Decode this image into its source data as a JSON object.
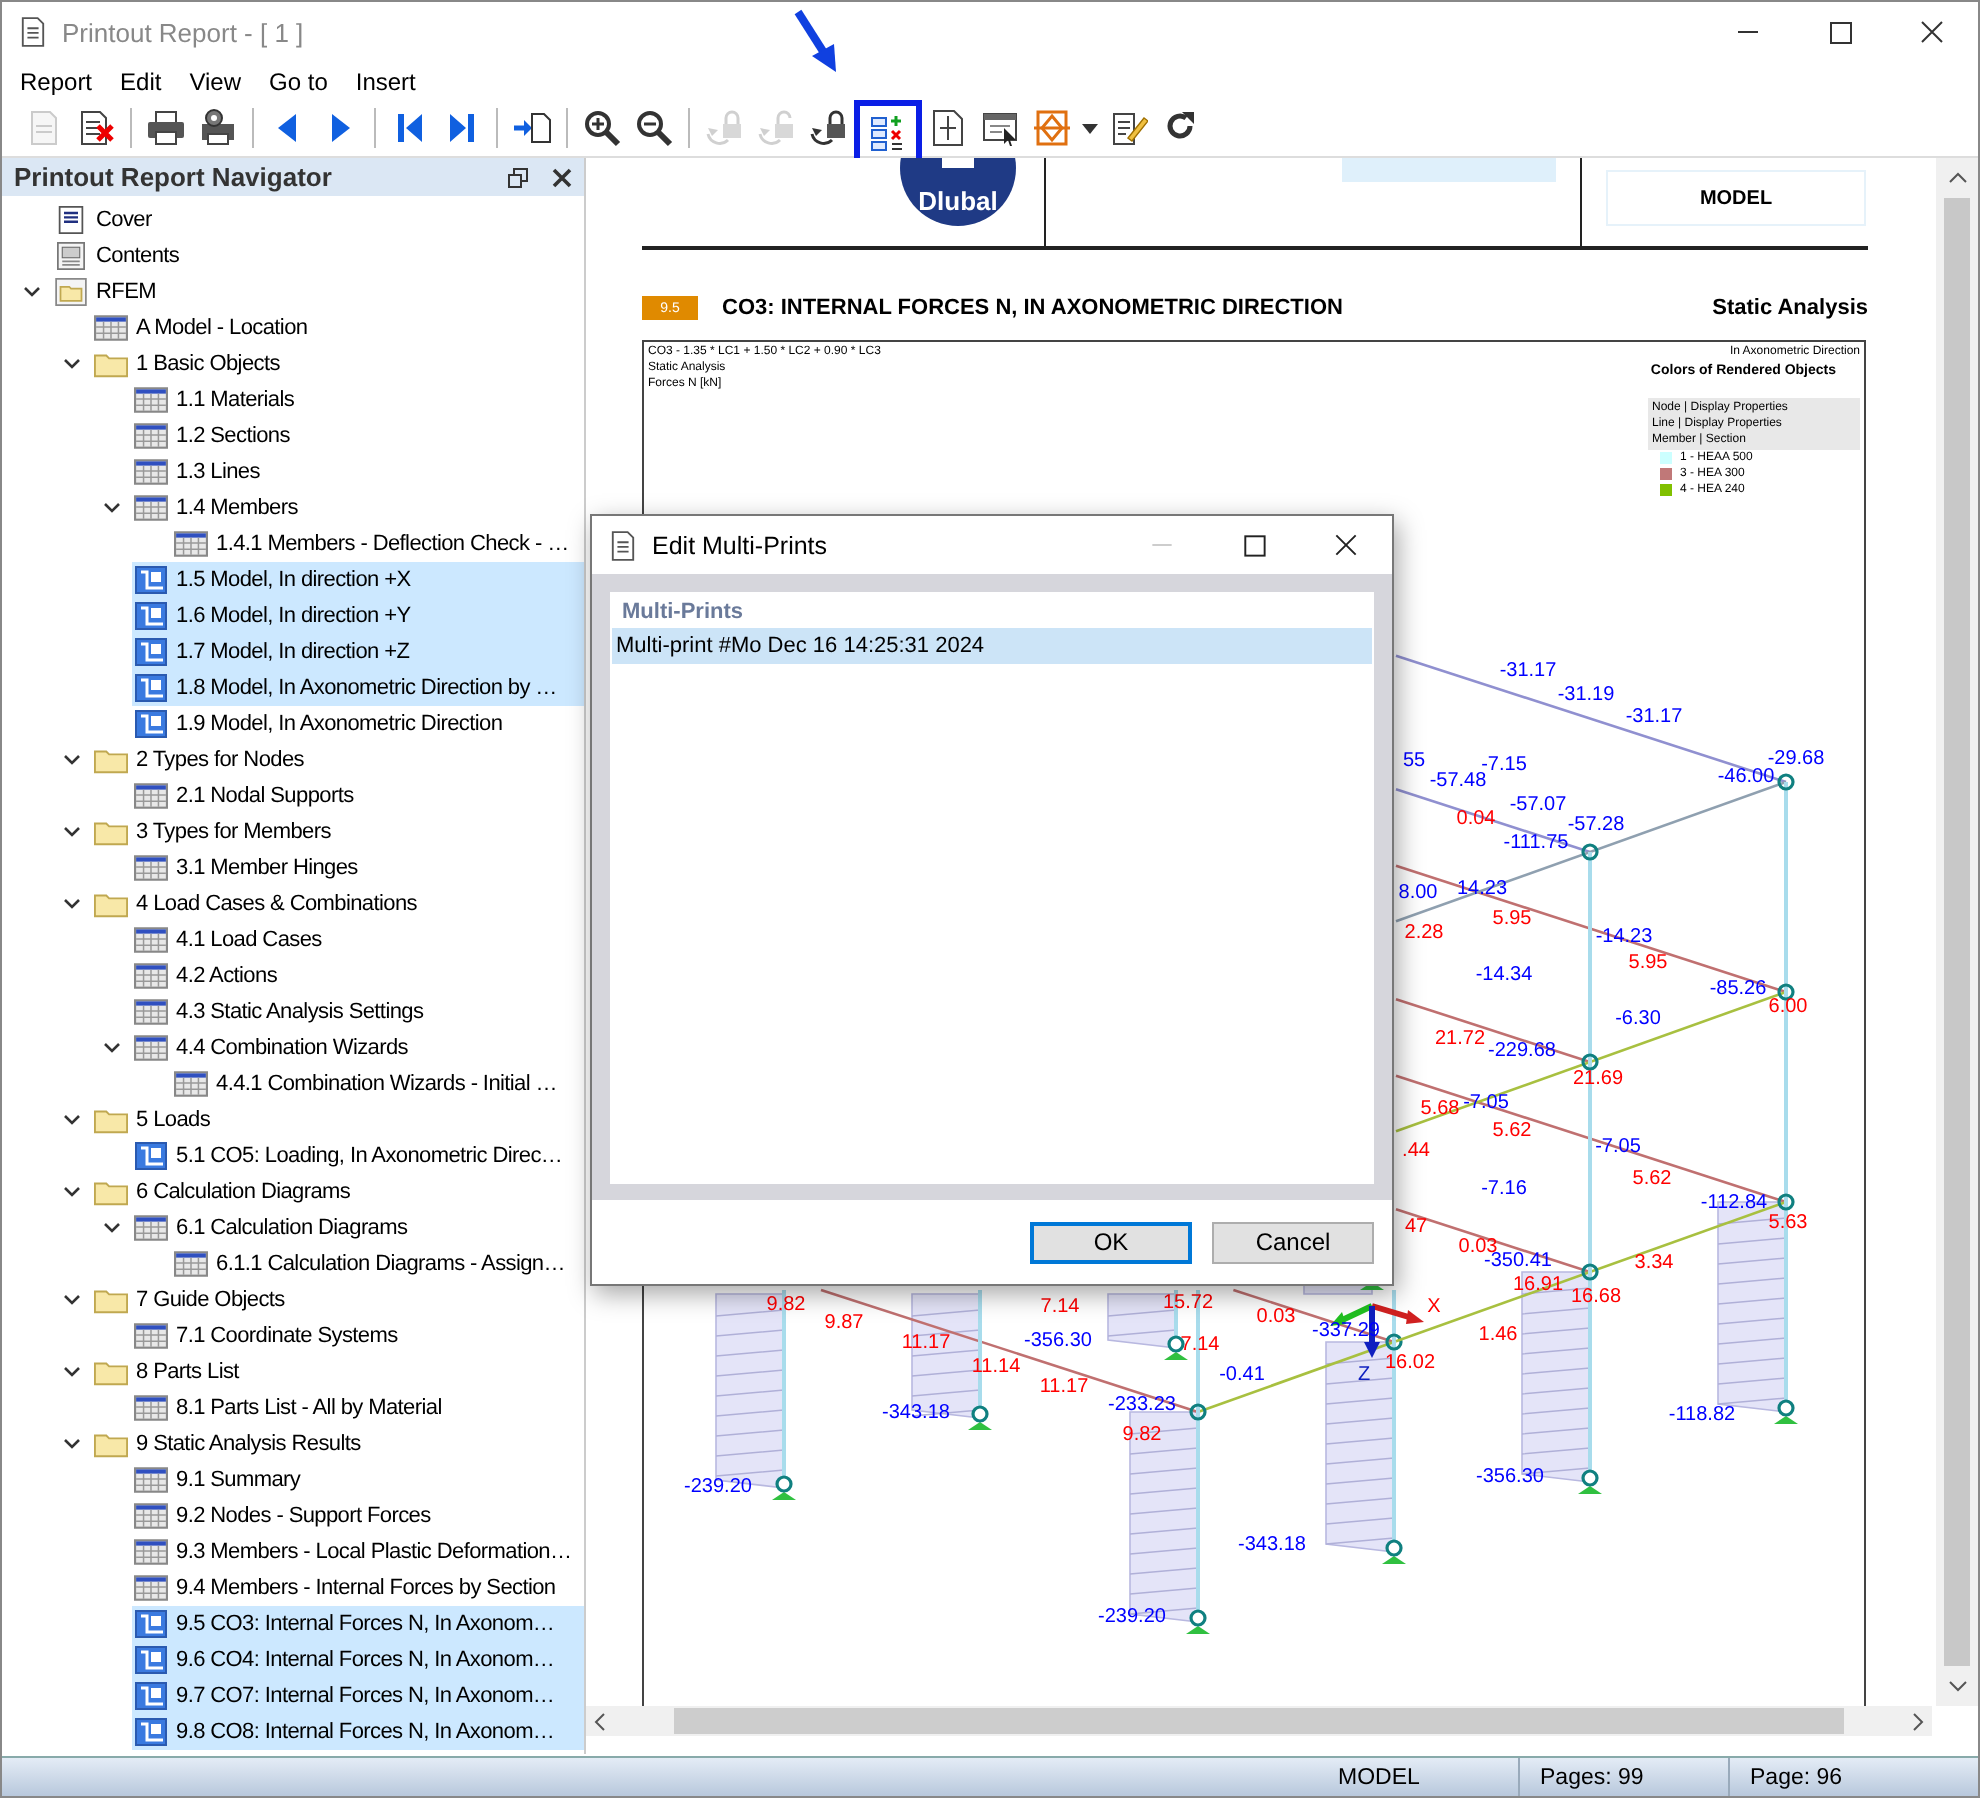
{
  "window": {
    "title": "Printout Report - [ 1 ]"
  },
  "menu": [
    "Report",
    "Edit",
    "View",
    "Go to",
    "Insert"
  ],
  "toolbar": [
    [
      {
        "kind": "page",
        "disabled": true,
        "highlighted": false
      },
      {
        "kind": "delete-page",
        "disabled": false,
        "highlighted": false
      }
    ],
    [
      {
        "kind": "printer",
        "disabled": false,
        "highlighted": false
      },
      {
        "kind": "printer-settings",
        "disabled": false,
        "highlighted": false
      }
    ],
    [
      {
        "kind": "previous",
        "disabled": false,
        "highlighted": false
      },
      {
        "kind": "next",
        "disabled": false,
        "highlighted": false
      }
    ],
    [
      {
        "kind": "first",
        "disabled": false,
        "highlighted": false
      },
      {
        "kind": "last",
        "disabled": false,
        "highlighted": false
      }
    ],
    [
      {
        "kind": "insert-page",
        "disabled": false,
        "highlighted": false
      }
    ],
    [
      {
        "kind": "zoom-in",
        "disabled": false,
        "highlighted": false
      },
      {
        "kind": "zoom-out",
        "disabled": false,
        "highlighted": false
      }
    ],
    [
      {
        "kind": "lock",
        "disabled": true,
        "highlighted": false
      },
      {
        "kind": "unlock",
        "disabled": true,
        "highlighted": false
      },
      {
        "kind": "lock",
        "disabled": false,
        "highlighted": false
      },
      {
        "kind": "multi-print",
        "disabled": false,
        "highlighted": true
      },
      {
        "kind": "page-size",
        "disabled": false,
        "highlighted": false
      },
      {
        "kind": "window-select",
        "disabled": false,
        "highlighted": false
      },
      {
        "kind": "diamond-page",
        "disabled": false,
        "highlighted": false
      },
      {
        "kind": "dropdown",
        "disabled": false,
        "highlighted": false
      },
      {
        "kind": "edit",
        "disabled": false,
        "highlighted": false
      },
      {
        "kind": "refresh",
        "disabled": false,
        "highlighted": false
      }
    ]
  ],
  "navigator": {
    "title": "Printout Report Navigator",
    "items": [
      {
        "label": "Cover",
        "kind": "cover",
        "selected": false
      },
      {
        "label": "Contents",
        "kind": "contents",
        "selected": false
      },
      {
        "label": "RFEM",
        "kind": "root",
        "selected": false,
        "expanded": true,
        "children": [
          {
            "label": "A Model - Location",
            "kind": "table",
            "selected": false
          },
          {
            "label": "1 Basic Objects",
            "kind": "folder",
            "selected": false,
            "expanded": true,
            "children": [
              {
                "label": "1.1 Materials",
                "kind": "table",
                "selected": false
              },
              {
                "label": "1.2 Sections",
                "kind": "table",
                "selected": false
              },
              {
                "label": "1.3 Lines",
                "kind": "table",
                "selected": false
              },
              {
                "label": "1.4 Members",
                "kind": "table",
                "selected": false,
                "expanded": true,
                "children": [
                  {
                    "label": "1.4.1 Members - Deflection Check - …",
                    "kind": "table",
                    "selected": false
                  }
                ]
              },
              {
                "label": "1.5 Model, In direction +X",
                "kind": "image",
                "selected": true
              },
              {
                "label": "1.6 Model, In direction +Y",
                "kind": "image",
                "selected": true
              },
              {
                "label": "1.7 Model, In direction +Z",
                "kind": "image",
                "selected": true
              },
              {
                "label": "1.8 Model, In Axonometric Direction by …",
                "kind": "image",
                "selected": true
              },
              {
                "label": "1.9 Model, In Axonometric Direction",
                "kind": "image",
                "selected": false
              }
            ]
          },
          {
            "label": "2 Types for Nodes",
            "kind": "folder",
            "selected": false,
            "expanded": true,
            "children": [
              {
                "label": "2.1 Nodal Supports",
                "kind": "table",
                "selected": false
              }
            ]
          },
          {
            "label": "3 Types for Members",
            "kind": "folder",
            "selected": false,
            "expanded": true,
            "children": [
              {
                "label": "3.1 Member Hinges",
                "kind": "table",
                "selected": false
              }
            ]
          },
          {
            "label": "4 Load Cases & Combinations",
            "kind": "folder",
            "selected": false,
            "expanded": true,
            "children": [
              {
                "label": "4.1 Load Cases",
                "kind": "table",
                "selected": false
              },
              {
                "label": "4.2 Actions",
                "kind": "table",
                "selected": false
              },
              {
                "label": "4.3 Static Analysis Settings",
                "kind": "table",
                "selected": false
              },
              {
                "label": "4.4 Combination Wizards",
                "kind": "table",
                "selected": false,
                "expanded": true,
                "children": [
                  {
                    "label": "4.4.1 Combination Wizards - Initial …",
                    "kind": "table",
                    "selected": false
                  }
                ]
              }
            ]
          },
          {
            "label": "5 Loads",
            "kind": "folder",
            "selected": false,
            "expanded": true,
            "children": [
              {
                "label": "5.1 CO5: Loading, In Axonometric Direc…",
                "kind": "image",
                "selected": false
              }
            ]
          },
          {
            "label": "6 Calculation Diagrams",
            "kind": "folder",
            "selected": false,
            "expanded": true,
            "children": [
              {
                "label": "6.1 Calculation Diagrams",
                "kind": "table",
                "selected": false,
                "expanded": true,
                "children": [
                  {
                    "label": "6.1.1 Calculation Diagrams - Assign…",
                    "kind": "table",
                    "selected": false
                  }
                ]
              }
            ]
          },
          {
            "label": "7 Guide Objects",
            "kind": "folder",
            "selected": false,
            "expanded": true,
            "children": [
              {
                "label": "7.1 Coordinate Systems",
                "kind": "table",
                "selected": false
              }
            ]
          },
          {
            "label": "8 Parts List",
            "kind": "folder",
            "selected": false,
            "expanded": true,
            "children": [
              {
                "label": "8.1 Parts List - All by Material",
                "kind": "table",
                "selected": false
              }
            ]
          },
          {
            "label": "9 Static Analysis Results",
            "kind": "folder",
            "selected": false,
            "expanded": true,
            "children": [
              {
                "label": "9.1 Summary",
                "kind": "table",
                "selected": false
              },
              {
                "label": "9.2 Nodes - Support Forces",
                "kind": "table",
                "selected": false
              },
              {
                "label": "9.3 Members - Local Plastic Deformation…",
                "kind": "table",
                "selected": false
              },
              {
                "label": "9.4 Members - Internal Forces by Section",
                "kind": "table",
                "selected": false
              },
              {
                "label": "9.5 CO3: Internal Forces N, In Axonom…",
                "kind": "image",
                "selected": true
              },
              {
                "label": "9.6 CO4: Internal Forces N, In Axonom…",
                "kind": "image",
                "selected": true
              },
              {
                "label": "9.7 CO7: Internal Forces N, In Axonom…",
                "kind": "image",
                "selected": true
              },
              {
                "label": "9.8 CO8: Internal Forces N, In Axonom…",
                "kind": "image",
                "selected": true
              }
            ]
          }
        ]
      }
    ]
  },
  "document": {
    "logo": "Dlubal",
    "model_label": "MODEL",
    "section": {
      "number": "9.5",
      "title": "CO3: INTERNAL FORCES N, IN AXONOMETRIC DIRECTION",
      "category": "Static Analysis"
    },
    "figure": {
      "info": [
        "CO3 - 1.35 * LC1 + 1.50 * LC2 + 0.90 * LC3",
        "Static Analysis",
        "Forces N [kN]"
      ],
      "direction": "In Axonometric Direction",
      "legend_title": "Colors of Rendered Objects",
      "legend_header": [
        "Node | Display Properties",
        "Line | Display Properties",
        "Member | Section"
      ],
      "legend_items": [
        {
          "label": "1 - HEAA 500",
          "color": "#ccffff"
        },
        {
          "label": "3 - HEA 300",
          "color": "#c07878"
        },
        {
          "label": "4 - HEA 240",
          "color": "#80c000"
        }
      ],
      "axes": [
        "X",
        "Z"
      ],
      "labels": [
        {
          "text": "-31.17",
          "color": "#0000ff"
        },
        {
          "text": "-31.19",
          "color": "#0000ff"
        },
        {
          "text": "-31.17",
          "color": "#0000ff"
        },
        {
          "text": "55",
          "color": "#0000ff"
        },
        {
          "text": "-7.15",
          "color": "#0000ff"
        },
        {
          "text": "-29.68",
          "color": "#0000ff"
        },
        {
          "text": "-57.48",
          "color": "#0000ff"
        },
        {
          "text": "-46.00",
          "color": "#0000ff"
        },
        {
          "text": "-57.07",
          "color": "#0000ff"
        },
        {
          "text": "0.04",
          "color": "#ff0000"
        },
        {
          "text": "-57.28",
          "color": "#0000ff"
        },
        {
          "text": "-111.75",
          "color": "#0000ff"
        },
        {
          "text": "8.00",
          "color": "#0000ff"
        },
        {
          "text": "14.23",
          "color": "#0000ff"
        },
        {
          "text": "5.95",
          "color": "#ff0000"
        },
        {
          "text": "2.28",
          "color": "#ff0000"
        },
        {
          "text": "-14.23",
          "color": "#0000ff"
        },
        {
          "text": "5.95",
          "color": "#ff0000"
        },
        {
          "text": "-14.34",
          "color": "#0000ff"
        },
        {
          "text": "-85.26",
          "color": "#0000ff"
        },
        {
          "text": "6.00",
          "color": "#ff0000"
        },
        {
          "text": "-6.30",
          "color": "#0000ff"
        },
        {
          "text": "21.72",
          "color": "#ff0000"
        },
        {
          "text": "-229.68",
          "color": "#0000ff"
        },
        {
          "text": "21.69",
          "color": "#ff0000"
        },
        {
          "text": "5.68",
          "color": "#ff0000"
        },
        {
          "text": "-7.05",
          "color": "#0000ff"
        },
        {
          "text": "5.62",
          "color": "#ff0000"
        },
        {
          "text": ".44",
          "color": "#ff0000"
        },
        {
          "text": "-7.05",
          "color": "#0000ff"
        },
        {
          "text": "5.62",
          "color": "#ff0000"
        },
        {
          "text": "-7.16",
          "color": "#0000ff"
        },
        {
          "text": "-112.84",
          "color": "#0000ff"
        },
        {
          "text": "47",
          "color": "#ff0000"
        },
        {
          "text": "5.63",
          "color": "#ff0000"
        },
        {
          "text": "0.03",
          "color": "#ff0000"
        },
        {
          "text": "-350.41",
          "color": "#0000ff"
        },
        {
          "text": "3.34",
          "color": "#ff0000"
        },
        {
          "text": "9.82",
          "color": "#ff0000"
        },
        {
          "text": "7.14",
          "color": "#ff0000"
        },
        {
          "text": "15.72",
          "color": "#ff0000"
        },
        {
          "text": "16.91",
          "color": "#ff0000"
        },
        {
          "text": "16.68",
          "color": "#ff0000"
        },
        {
          "text": "9.87",
          "color": "#ff0000"
        },
        {
          "text": "0.03",
          "color": "#ff0000"
        },
        {
          "text": "11.17",
          "color": "#ff0000"
        },
        {
          "text": "-356.30",
          "color": "#0000ff"
        },
        {
          "text": "7.14",
          "color": "#ff0000"
        },
        {
          "text": "-337.29",
          "color": "#0000ff"
        },
        {
          "text": "1.46",
          "color": "#ff0000"
        },
        {
          "text": "11.14",
          "color": "#ff0000"
        },
        {
          "text": "-0.41",
          "color": "#0000ff"
        },
        {
          "text": "16.02",
          "color": "#ff0000"
        },
        {
          "text": "11.17",
          "color": "#ff0000"
        },
        {
          "text": "-343.18",
          "color": "#0000ff"
        },
        {
          "text": "-233.23",
          "color": "#0000ff"
        },
        {
          "text": "-118.82",
          "color": "#0000ff"
        },
        {
          "text": "9.82",
          "color": "#ff0000"
        },
        {
          "text": "-239.20",
          "color": "#0000ff"
        },
        {
          "text": "-356.30",
          "color": "#0000ff"
        },
        {
          "text": "-343.18",
          "color": "#0000ff"
        },
        {
          "text": "-239.20",
          "color": "#0000ff"
        }
      ]
    }
  },
  "dialog": {
    "title": "Edit Multi-Prints",
    "list_header": "Multi-Prints",
    "items": [
      {
        "label": "Multi-print #Mo Dec 16 14:25:31 2024",
        "selected": true
      }
    ],
    "buttons": [
      {
        "label": "OK",
        "default": true
      },
      {
        "label": "Cancel",
        "default": false
      }
    ]
  },
  "status_bar": [
    "MODEL",
    "Pages: 99",
    "Page: 96"
  ]
}
